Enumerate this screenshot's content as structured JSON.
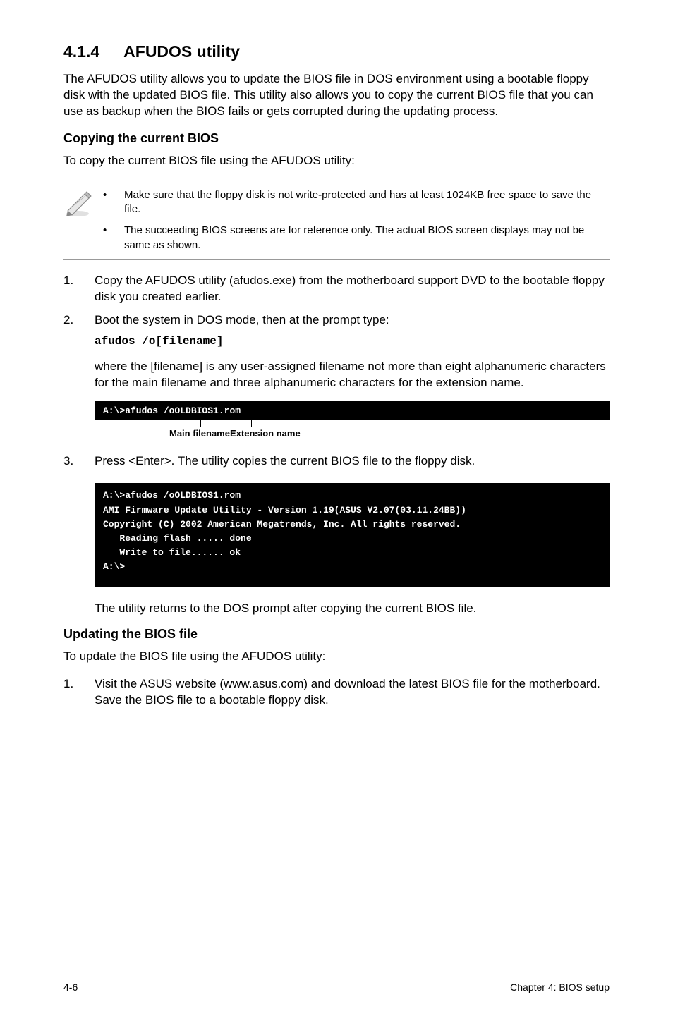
{
  "heading": {
    "num": "4.1.4",
    "title": "AFUDOS utility"
  },
  "intro": "The AFUDOS utility allows you to update the BIOS file in DOS environment using a bootable floppy disk with the updated BIOS file. This utility also allows you to copy the current BIOS file that you can use as backup when the BIOS fails or gets corrupted during the updating process.",
  "sub1": "Copying the current BIOS",
  "sub1_lead": "To copy the current BIOS file using the AFUDOS utility:",
  "notes": [
    "Make sure that the floppy disk is not write-protected and has at least 1024KB free space to save the file.",
    "The succeeding BIOS screens are for reference only. The actual BIOS screen displays may not be same as shown."
  ],
  "steps_a": {
    "s1_num": "1.",
    "s1": "Copy the AFUDOS utility (afudos.exe) from the motherboard support DVD to the bootable floppy disk you created earlier.",
    "s2_num": "2.",
    "s2": "Boot the system in DOS mode, then at the prompt type:",
    "s2_code": "afudos /o[filename]",
    "s2_after": "where the [filename] is any user-assigned filename not more than eight alphanumeric characters  for the main filename and three alphanumeric characters for the extension name."
  },
  "term1": {
    "prefix": "A:\\>afudos /",
    "mid": "oOLDBIOS1",
    "dot": ".",
    "ext": "rom"
  },
  "labels": {
    "main": "Main filename",
    "ext": "Extension name"
  },
  "steps_b": {
    "s3_num": "3.",
    "s3": "Press <Enter>. The utility copies the current BIOS file to the floppy disk."
  },
  "term2": [
    "A:\\>afudos /oOLDBIOS1.rom",
    "AMI Firmware Update Utility - Version 1.19(ASUS V2.07(03.11.24BB))",
    "Copyright (C) 2002 American Megatrends, Inc. All rights reserved.",
    "   Reading flash ..... done",
    "   Write to file...... ok",
    "A:\\>"
  ],
  "after_term2": "The utility returns to the DOS prompt after copying the current BIOS file.",
  "sub2": "Updating the BIOS file",
  "sub2_lead": "To update the BIOS file using the AFUDOS utility:",
  "steps_c": {
    "s1_num": "1.",
    "s1": "Visit the ASUS website (www.asus.com) and download the latest BIOS file for the motherboard. Save the BIOS file to a bootable floppy disk."
  },
  "footer": {
    "left": "4-6",
    "right": "Chapter 4: BIOS setup"
  }
}
